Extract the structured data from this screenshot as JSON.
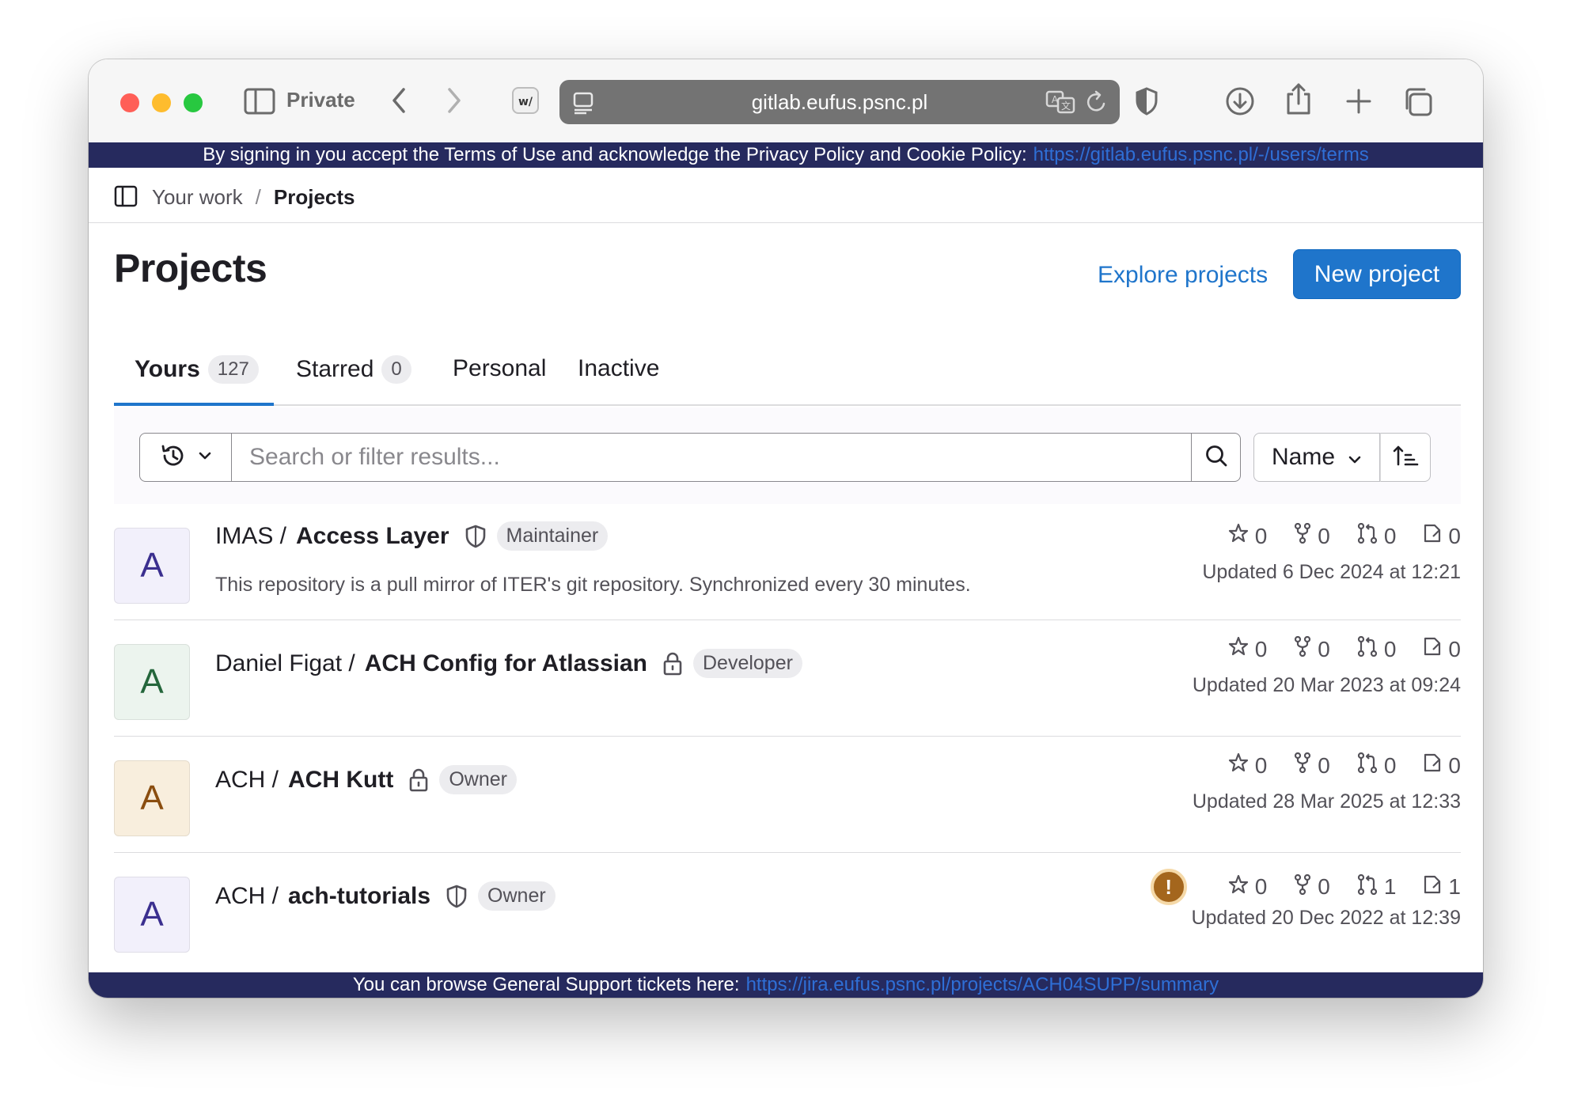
{
  "browser": {
    "private_label": "Private",
    "url": "gitlab.eufus.psnc.pl"
  },
  "banner_top": {
    "text": "By signing in you accept the Terms of Use and acknowledge the Privacy Policy and Cookie Policy:",
    "link": "https://gitlab.eufus.psnc.pl/-/users/terms"
  },
  "banner_bottom": {
    "text": "You can browse General Support tickets here:",
    "link": "https://jira.eufus.psnc.pl/projects/ACH04SUPP/summary"
  },
  "breadcrumb": {
    "parent": "Your work",
    "separator": "/",
    "current": "Projects"
  },
  "header": {
    "title": "Projects",
    "explore_label": "Explore projects",
    "new_project_label": "New project"
  },
  "tabs": [
    {
      "label": "Yours",
      "count": "127"
    },
    {
      "label": "Starred",
      "count": "0"
    },
    {
      "label": "Personal"
    },
    {
      "label": "Inactive"
    }
  ],
  "filter": {
    "placeholder": "Search or filter results...",
    "sort_label": "Name"
  },
  "projects": [
    {
      "namespace": "IMAS /",
      "name": "Access Layer",
      "visibility_icon": "shield-icon",
      "role": "Maintainer",
      "description": "This repository is a pull mirror of ITER's git repository. Synchronized every 30 minutes.",
      "stars": "0",
      "forks": "0",
      "merge_requests": "0",
      "issues": "0",
      "updated": "Updated 6 Dec 2024 at 12:21",
      "avatar_letter": "A",
      "avatar_bg": "#f2f0fb",
      "avatar_fg": "#3b2f8f"
    },
    {
      "namespace": "Daniel Figat /",
      "name": "ACH Config for Atlassian",
      "visibility_icon": "lock-icon",
      "role": "Developer",
      "stars": "0",
      "forks": "0",
      "merge_requests": "0",
      "issues": "0",
      "updated": "Updated 20 Mar 2023 at 09:24",
      "avatar_letter": "A",
      "avatar_bg": "#ecf4ee",
      "avatar_fg": "#24663b"
    },
    {
      "namespace": "ACH /",
      "name": "ACH Kutt",
      "visibility_icon": "lock-icon",
      "role": "Owner",
      "stars": "0",
      "forks": "0",
      "merge_requests": "0",
      "issues": "0",
      "updated": "Updated 28 Mar 2025 at 12:33",
      "avatar_letter": "A",
      "avatar_bg": "#f8eedd",
      "avatar_fg": "#8a4d0f"
    },
    {
      "namespace": "ACH /",
      "name": "ach-tutorials",
      "visibility_icon": "shield-icon",
      "role": "Owner",
      "warning_glyph": "!",
      "stars": "0",
      "forks": "0",
      "merge_requests": "1",
      "issues": "1",
      "updated": "Updated 20 Dec 2022 at 12:39",
      "avatar_letter": "A",
      "avatar_bg": "#f2f0fb",
      "avatar_fg": "#3b2f8f"
    }
  ]
}
